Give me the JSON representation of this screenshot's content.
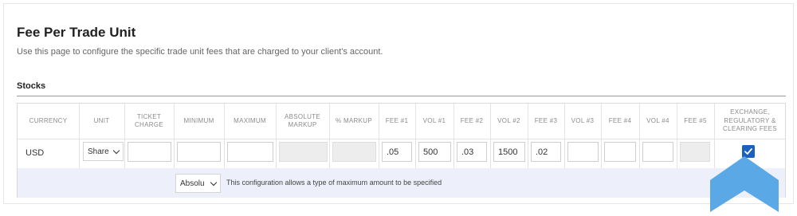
{
  "page": {
    "title": "Fee Per Trade Unit",
    "description": "Use this page to configure the specific trade unit fees that are charged to your client's account."
  },
  "section": {
    "title": "Stocks"
  },
  "table": {
    "headers": {
      "currency": "CURRENCY",
      "unit": "UNIT",
      "ticket_charge": "TICKET CHARGE",
      "minimum": "MINIMUM",
      "maximum": "MAXIMUM",
      "absolute_markup": "ABSOLUTE MARKUP",
      "pct_markup": "% MARKUP",
      "fee1": "FEE #1",
      "vol1": "VOL #1",
      "fee2": "FEE #2",
      "vol2": "VOL #2",
      "fee3": "FEE #3",
      "vol3": "VOL #3",
      "fee4": "FEE #4",
      "vol4": "VOL #4",
      "fee5": "FEE #5",
      "exchange": "EXCHANGE, REGULATORY & CLEARING FEES"
    },
    "row": {
      "currency": "USD",
      "unit": "Share",
      "ticket_charge": "",
      "minimum": "",
      "maximum": "",
      "absolute_markup": "",
      "pct_markup": "",
      "fee1": ".05",
      "vol1": "500",
      "fee2": ".03",
      "vol2": "1500",
      "fee3": ".02",
      "vol3": "",
      "fee4": "",
      "vol4": "",
      "fee5": "",
      "exchange_checked": true
    },
    "config_row": {
      "maximum_type": "Absolu",
      "note": "This configuration allows a type of maximum amount to be specified"
    }
  },
  "colors": {
    "accent": "#1b5fbf",
    "cursor": "#5aa9e6",
    "config_row_bg": "#edf0fb"
  }
}
